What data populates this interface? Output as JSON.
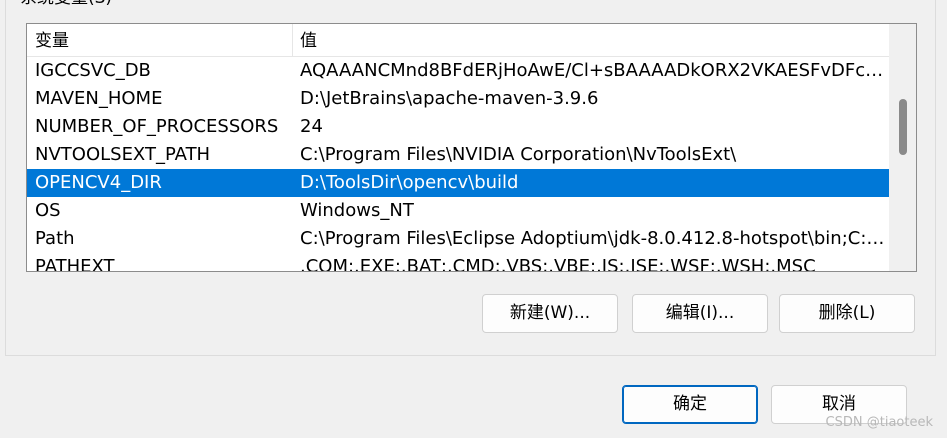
{
  "group": {
    "title": "系统变量(S)"
  },
  "list": {
    "headers": {
      "variable": "变量",
      "value": "值"
    },
    "rows": [
      {
        "name": "IGCCSVC_DB",
        "value": "AQAAANCMnd8BFdERjHoAwE/Cl+sBAAAADkORX2VKAESFvDFcF...",
        "selected": false
      },
      {
        "name": "MAVEN_HOME",
        "value": "D:\\JetBrains\\apache-maven-3.9.6",
        "selected": false
      },
      {
        "name": "NUMBER_OF_PROCESSORS",
        "value": "24",
        "selected": false
      },
      {
        "name": "NVTOOLSEXT_PATH",
        "value": "C:\\Program Files\\NVIDIA Corporation\\NvToolsExt\\",
        "selected": false
      },
      {
        "name": "OPENCV4_DIR",
        "value": "D:\\ToolsDir\\opencv\\build",
        "selected": true
      },
      {
        "name": "OS",
        "value": "Windows_NT",
        "selected": false
      },
      {
        "name": "Path",
        "value": "C:\\Program Files\\Eclipse Adoptium\\jdk-8.0.412.8-hotspot\\bin;C:\\P...",
        "selected": false
      },
      {
        "name": "PATHEXT",
        "value": ".COM;.EXE;.BAT;.CMD;.VBS;.VBE;.JS;.JSE;.WSF;.WSH;.MSC",
        "selected": false
      }
    ]
  },
  "buttons": {
    "new": "新建(W)...",
    "edit": "编辑(I)...",
    "delete": "删除(L)",
    "ok": "确定",
    "cancel": "取消"
  },
  "watermark": "CSDN @tiaoteek",
  "colors": {
    "selection": "#0078d7",
    "primary_border": "#0067c0"
  }
}
